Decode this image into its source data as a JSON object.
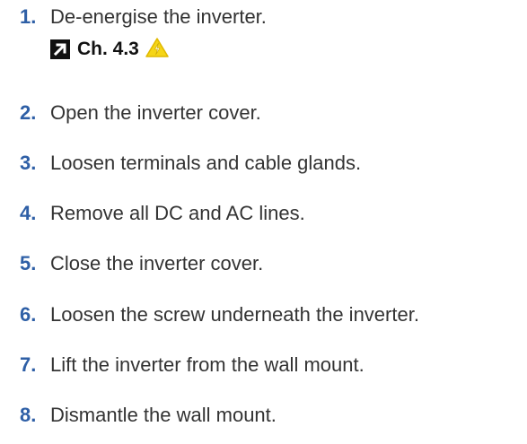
{
  "steps": [
    {
      "number": "1.",
      "text": "De-energise the inverter."
    },
    {
      "number": "2.",
      "text": "Open the inverter cover."
    },
    {
      "number": "3.",
      "text": "Loosen terminals and cable glands."
    },
    {
      "number": "4.",
      "text": "Remove all DC and AC lines."
    },
    {
      "number": "5.",
      "text": "Close the inverter cover."
    },
    {
      "number": "6.",
      "text": "Loosen the screw underneath the inverter."
    },
    {
      "number": "7.",
      "text": "Lift the inverter from the wall mount."
    },
    {
      "number": "8.",
      "text": "Dismantle the wall mount."
    }
  ],
  "reference": {
    "label": "Ch. 4.3",
    "link_icon": "arrow-up-right-icon",
    "warning_icon": "electrical-hazard-warning-icon"
  },
  "colors": {
    "step_number": "#2e5fa6",
    "text": "#333333",
    "warning_fill": "#f5d517"
  }
}
